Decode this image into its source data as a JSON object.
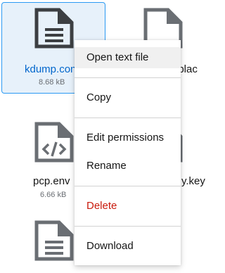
{
  "files": [
    {
      "name": "kdump.conf",
      "size": "8.68 kB",
      "icon": "text-file-icon",
      "selected": true
    },
    {
      "name": "…t.blac",
      "size": "",
      "icon": "file-icon"
    },
    {
      "name": "pcp.env",
      "size": "6.66 kB",
      "icon": "code-file-icon"
    },
    {
      "name": "…y.key",
      "size": "",
      "icon": "file-icon"
    },
    {
      "name": "",
      "size": "",
      "icon": "text-file-icon"
    }
  ],
  "context_menu": {
    "open_text_file": "Open text file",
    "copy": "Copy",
    "edit_permissions": "Edit permissions",
    "rename": "Rename",
    "delete": "Delete",
    "download": "Download"
  },
  "colors": {
    "selection_border": "#2b9af3",
    "selection_bg": "#e7f1fa",
    "selected_name": "#06c",
    "danger": "#c9190b",
    "icon": "#3c3f42",
    "icon_muted": "#6a6e73"
  }
}
